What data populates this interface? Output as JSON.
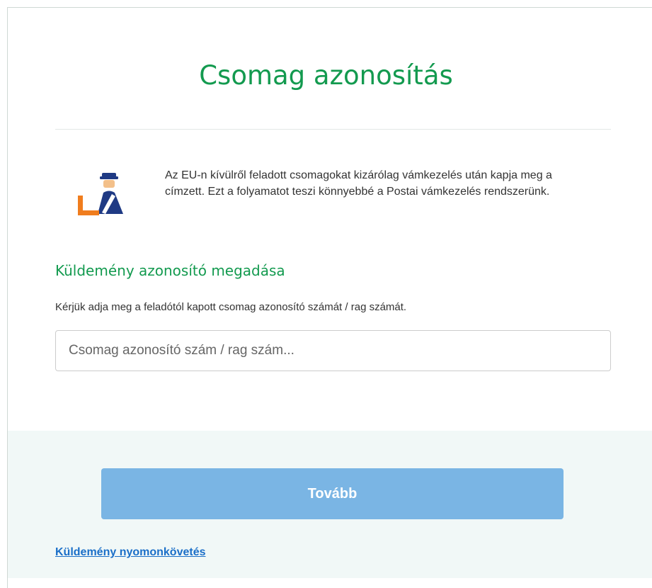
{
  "page": {
    "title": "Csomag azonosítás",
    "info_text": "Az EU-n kívülről feladott csomagokat kizárólag vámkezelés után kapja meg a címzett. Ezt a folyamatot teszi könnyebbé a Postai vámkezelés rendszerünk.",
    "info_icon": "customs-officer-icon"
  },
  "form": {
    "heading": "Küldemény azonosító megadása",
    "instruction": "Kérjük adja meg a feladótól kapott csomag azonosító számát / rag számát.",
    "input_value": "",
    "input_placeholder": "Csomag azonosító szám / rag szám..."
  },
  "footer": {
    "next_button_label": "Tovább",
    "tracking_link_label": "Küldemény nyomonkövetés"
  },
  "colors": {
    "accent_green": "#139a4f",
    "button_blue": "#7ab5e4",
    "link_blue": "#1b6fc8",
    "footer_bg": "#f1f8f7",
    "icon_orange": "#f07d1e",
    "icon_navy": "#1f3a84"
  }
}
